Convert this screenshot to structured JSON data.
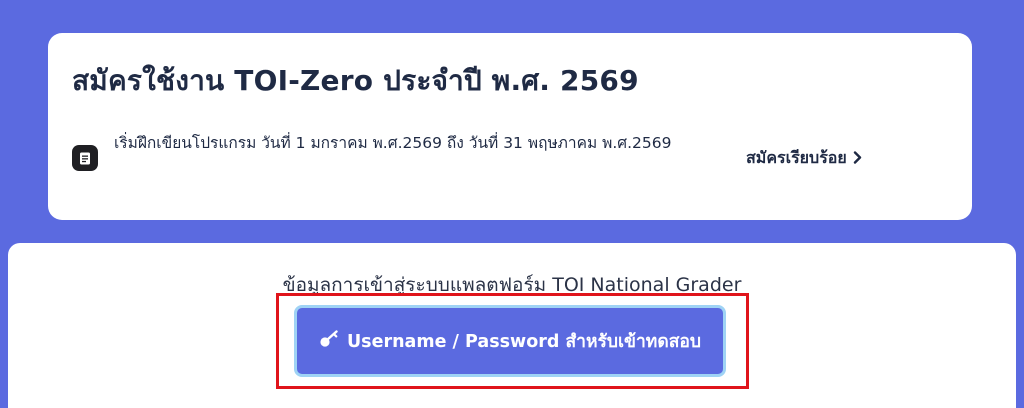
{
  "registration": {
    "title": "สมัครใช้งาน TOI-Zero ประจำปี พ.ศ. 2569",
    "description": "เริ่มฝึกเขียนโปรแกรม วันที่ 1 มกราคม พ.ศ.2569 ถึง วันที่ 31 พฤษภาคม พ.ศ.2569",
    "status_label": "สมัครเรียบร้อย",
    "icon": "document-icon",
    "status_icon": "chevron-right-icon"
  },
  "platform": {
    "heading": "ข้อมูลการเข้าสู่ระบบแพลตฟอร์ม TOI National Grader",
    "button_label": "Username / Password สำหรับเข้าทดสอบ",
    "button_icon": "key-icon"
  },
  "colors": {
    "background": "#5b6ae0",
    "card": "#ffffff",
    "text": "#1f2a44",
    "button": "#5b6ae0",
    "button_border": "#9fd3f5",
    "highlight": "#e0141b"
  }
}
